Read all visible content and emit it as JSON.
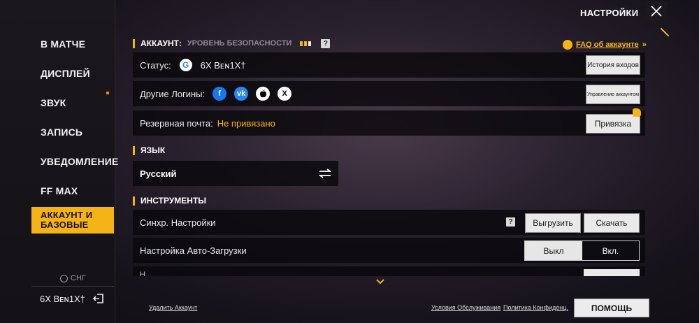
{
  "sidebar": {
    "items": [
      {
        "label": "В МАТЧЕ",
        "active": false
      },
      {
        "label": "ДИСПЛЕЙ",
        "active": false
      },
      {
        "label": "ЗВУК",
        "active": false
      },
      {
        "label": "ЗАПИСЬ",
        "active": false
      },
      {
        "label": "УВЕДОМЛЕНИЕ",
        "active": false
      },
      {
        "label": "FF MAX",
        "active": false
      },
      {
        "label": "АККАУНТ И БАЗОВЫЕ",
        "active": true
      }
    ],
    "region": "СНГ",
    "user": "6X  Bᴇɴ1X†"
  },
  "header": {
    "title": "НАСТРОЙКИ"
  },
  "account": {
    "section_title": "АККАУНТ:",
    "security_label": "УРОВЕНЬ БЕЗОПАСНОСТИ",
    "help": "?",
    "faq_link": "FAQ об аккаунте",
    "faq_arrow": "»",
    "status_label": "Статус:",
    "status_google": "G",
    "status_name": "6X   Bᴇɴ1X†",
    "login_history_btn": "История входов",
    "other_logins_label": "Другие Логины:",
    "social_icons": [
      "f",
      "vk",
      "",
      "X"
    ],
    "manage_account_btn": "Управление аккаунтом",
    "backup_email_label": "Резервная почта:",
    "backup_email_value": "Не привязано",
    "bind_btn": "Привязка"
  },
  "language": {
    "section_title": "ЯЗЫК",
    "value": "Русский"
  },
  "tools": {
    "section_title": "ИНСТРУМЕНТЫ",
    "sync_label": "Синхр. Настройки",
    "help": "?",
    "upload_btn": "Выгрузить",
    "download_btn": "Скачать",
    "auto_download_label": "Настройка Авто-Загрузки",
    "toggle_off": "Выкл",
    "toggle_on": "Вкл.",
    "cut_row_text": "Н..."
  },
  "footer": {
    "delete_account": "Удалить Аккаунт",
    "terms": "Условия Обслуживания",
    "privacy": "Политика Конфиденц.",
    "help_btn": "ПОМОЩЬ"
  },
  "colors": {
    "accent": "#f5b316",
    "row_bg": "#0a090c",
    "button_bg": "#e9e9e9"
  }
}
